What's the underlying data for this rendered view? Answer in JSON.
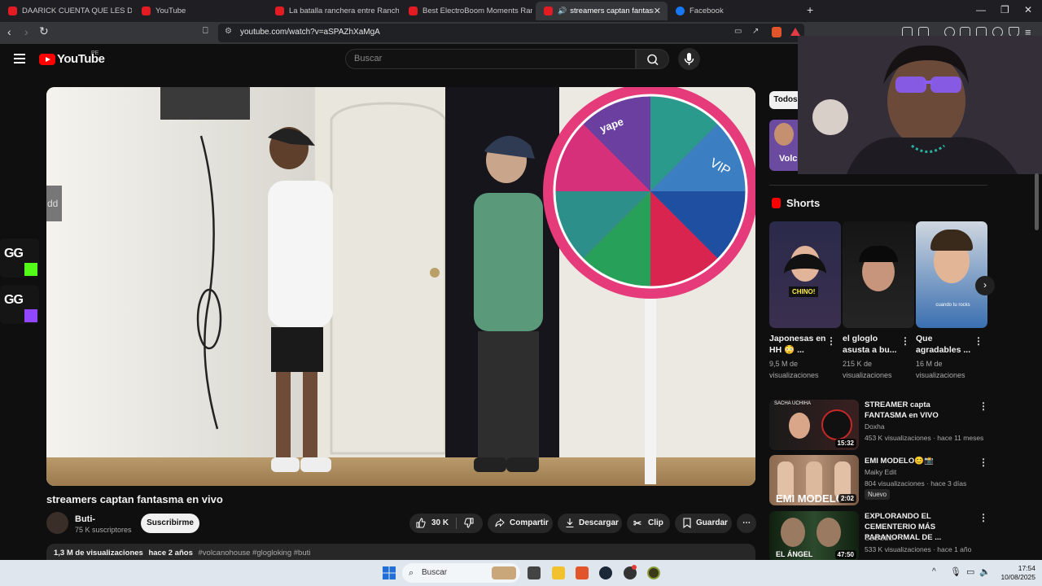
{
  "browser": {
    "tabs": [
      {
        "title": "DAARICK CUENTA QUE LES DIJO A S",
        "icon": "youtube-icon"
      },
      {
        "title": "YouTube",
        "icon": "youtube-icon"
      },
      {
        "title": "La batalla ranchera entre Rancho chi",
        "icon": "youtube-icon"
      },
      {
        "title": "Best ElectroBoom Moments Ranked",
        "icon": "youtube-icon"
      },
      {
        "title": "streamers captan fantasma en",
        "icon": "youtube-icon",
        "active": true
      },
      {
        "title": "Facebook",
        "icon": "facebook-icon"
      }
    ],
    "new_tab": "+",
    "url": "youtube.com/watch?v=aSPAZhXaMgA"
  },
  "youtube": {
    "logo_text": "YouTube",
    "region": "PE",
    "search_placeholder": "Buscar"
  },
  "overlay": {
    "side_tab": "dd",
    "gg_label": "GG"
  },
  "video": {
    "title": "streamers captan fantasma en vivo",
    "channel": "Buti-",
    "subscribers": "75 K suscriptores",
    "subscribe_label": "Suscribirme",
    "likes": "30 K",
    "share_label": "Compartir",
    "download_label": "Descargar",
    "clip_label": "Clip",
    "save_label": "Guardar",
    "more_label": "⋯",
    "views": "1,3 M de visualizaciones",
    "date": "hace 2 años",
    "tags": "#volcanohouse #glogloking #buti",
    "wheel_vip": "VIP",
    "wheel_logo": "yape"
  },
  "sidebar": {
    "chip_all": "Todos",
    "thumb0_label": "Volc",
    "shorts_title": "Shorts",
    "shorts": [
      {
        "title": "Japonesas en HH 😳 ...",
        "views": "9,5 M de visualizaciones",
        "caption": "CHINO!"
      },
      {
        "title": "el gloglo asusta a bu...",
        "views": "215 K de visualizaciones",
        "caption": ""
      },
      {
        "title": "Que agradables ...",
        "views": "16 M de visualizaciones",
        "caption": "cuando tu rocks"
      }
    ],
    "related": [
      {
        "title": "STREAMER capta FANTASMA en VIVO",
        "channel": "Doxha",
        "meta": "453 K visualizaciones · hace 11 meses",
        "duration": "15:32",
        "thumb_text": "SACHA UCHIHA"
      },
      {
        "title": "EMI MODELO😊📸",
        "channel": "Maiky Edit",
        "meta": "804 visualizaciones · hace 3 días",
        "duration": "2:02",
        "badge": "Nuevo",
        "thumb_text": "EMI MODELO"
      },
      {
        "title": "EXPLORANDO EL CEMENTERIO MÁS PARANORMAL DE ...",
        "channel": "GLOGLO+",
        "meta": "533 K visualizaciones · hace 1 año",
        "duration": "47:50",
        "thumb_text": "EL ÁNGEL"
      }
    ]
  },
  "taskbar": {
    "search_placeholder": "Buscar",
    "time": "17:54",
    "date": "10/08/2025"
  }
}
